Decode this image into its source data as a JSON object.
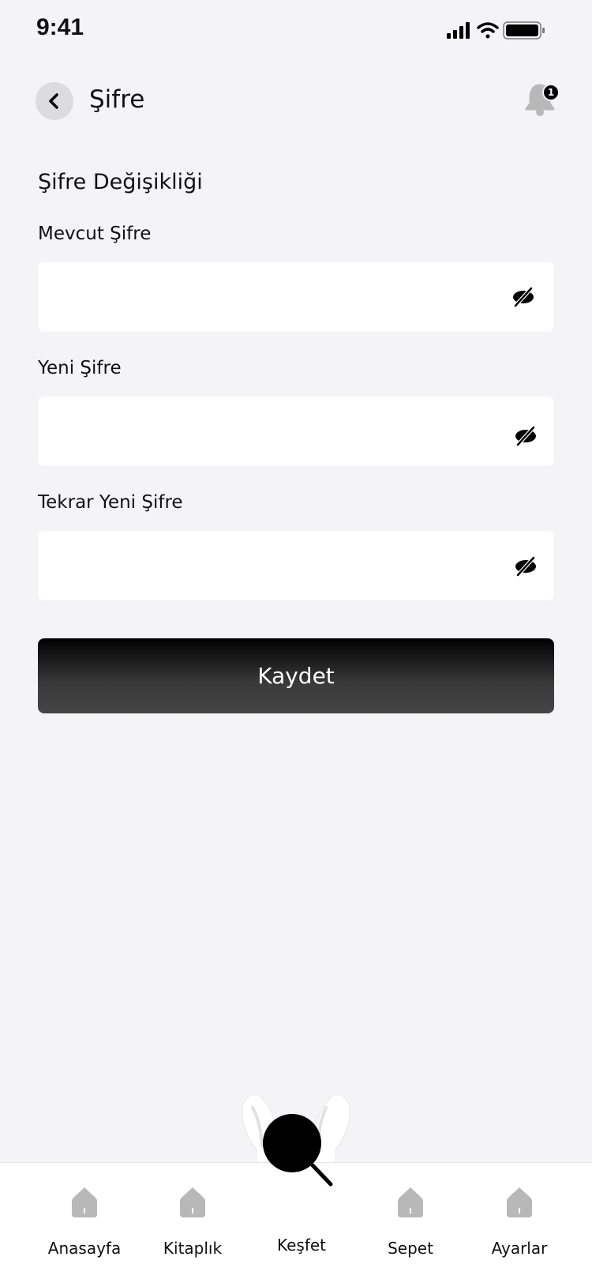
{
  "status_bar": {
    "time": "9:41"
  },
  "header": {
    "title": "Şifre",
    "back_icon": "chevron-left-icon",
    "notification_icon": "bell-icon",
    "notification_count": "1"
  },
  "form": {
    "section_title": "Şifre Değişikliği",
    "fields": [
      {
        "label": "Mevcut Şifre",
        "value": "",
        "placeholder": ""
      },
      {
        "label": "Yeni Şifre",
        "value": "",
        "placeholder": ""
      },
      {
        "label": "Tekrar Yeni Şifre",
        "value": "",
        "placeholder": ""
      }
    ],
    "toggle_icon": "eye-off-icon",
    "save_label": "Kaydet"
  },
  "tabbar": {
    "items": [
      {
        "label": "Anasayfa",
        "icon": "home-icon"
      },
      {
        "label": "Kitaplık",
        "icon": "home-icon"
      },
      {
        "label": "Keşfet",
        "icon": "search-icon",
        "active": true
      },
      {
        "label": "Sepet",
        "icon": "home-icon"
      },
      {
        "label": "Ayarlar",
        "icon": "home-icon"
      }
    ]
  },
  "colors": {
    "background": "#f4f4f6",
    "icon_inactive": "#b8b8b8",
    "button": "#000000"
  }
}
